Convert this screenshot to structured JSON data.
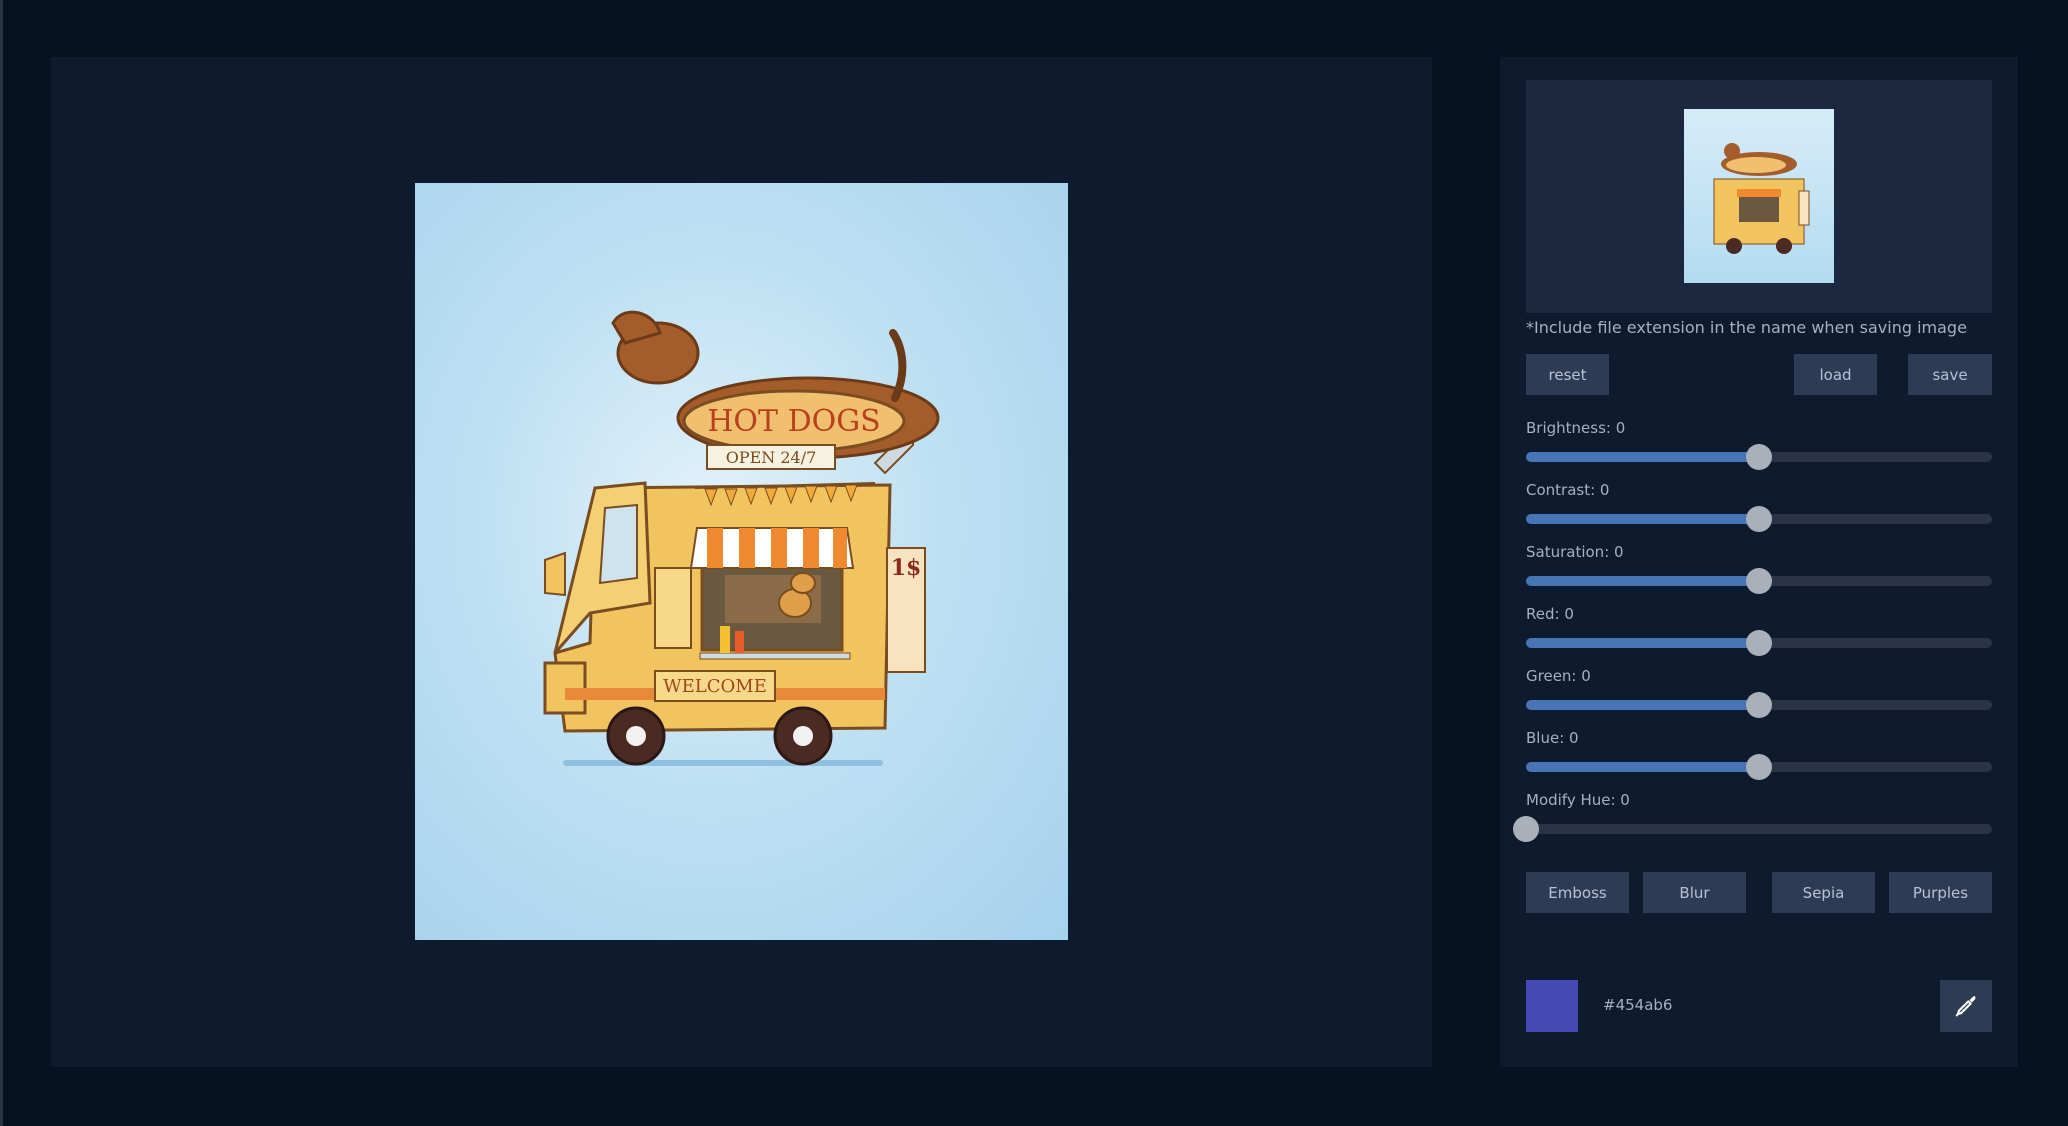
{
  "preview": {
    "note": "*Include file extension in the name when saving image"
  },
  "actions": {
    "reset_label": "reset",
    "load_label": "load",
    "save_label": "save"
  },
  "sliders": [
    {
      "label": "Brightness: 0",
      "value": 0,
      "fraction": 0.5
    },
    {
      "label": "Contrast: 0",
      "value": 0,
      "fraction": 0.5
    },
    {
      "label": "Saturation: 0",
      "value": 0,
      "fraction": 0.5
    },
    {
      "label": "Red: 0",
      "value": 0,
      "fraction": 0.5
    },
    {
      "label": "Green: 0",
      "value": 0,
      "fraction": 0.5
    },
    {
      "label": "Blue: 0",
      "value": 0,
      "fraction": 0.5
    },
    {
      "label": "Modify Hue: 0",
      "value": 0,
      "fraction": 0.0
    }
  ],
  "filters": {
    "emboss_label": "Emboss",
    "blur_label": "Blur",
    "sepia_label": "Sepia",
    "purples_label": "Purples"
  },
  "color": {
    "hex": "#454ab6",
    "swatch": "#454ab6",
    "picker_icon": "eyedropper-icon"
  },
  "image": {
    "sign_text": "HOT DOGS",
    "open_text": "OPEN 24/7",
    "welcome_text": "WELCOME",
    "price_text": "1$"
  },
  "colors": {
    "page_bg": "#061222",
    "panel_bg": "#0e1b2e",
    "button_bg": "#2d3b55",
    "slider_fill": "#4674b4",
    "slider_track": "#2a3446"
  }
}
